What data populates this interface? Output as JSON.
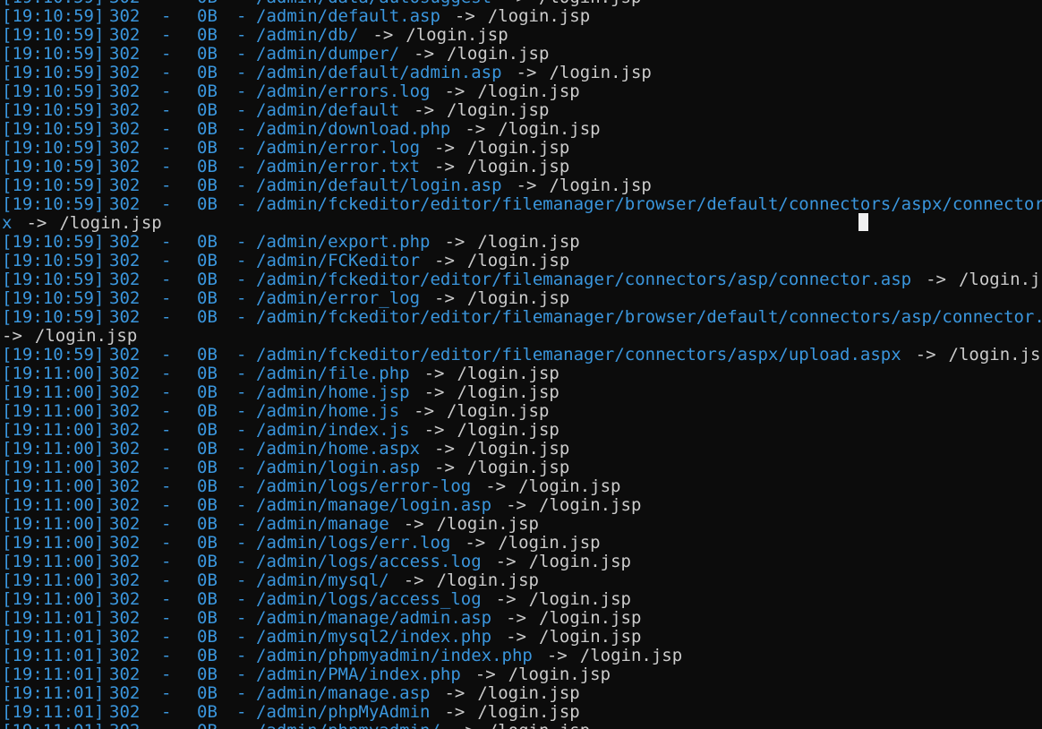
{
  "terminal": {
    "lines": [
      {
        "ts": "[19:10:59]",
        "code": "302",
        "dash": "-",
        "size": "0B",
        "sep": "-",
        "path": "/admin/data/autosuggest",
        "arrow": "->",
        "target": "/login.jsp"
      },
      {
        "ts": "[19:10:59]",
        "code": "302",
        "dash": "-",
        "size": "0B",
        "sep": "-",
        "path": "/admin/default.asp",
        "arrow": "->",
        "target": "/login.jsp"
      },
      {
        "ts": "[19:10:59]",
        "code": "302",
        "dash": "-",
        "size": "0B",
        "sep": "-",
        "path": "/admin/db/",
        "arrow": "->",
        "target": "/login.jsp"
      },
      {
        "ts": "[19:10:59]",
        "code": "302",
        "dash": "-",
        "size": "0B",
        "sep": "-",
        "path": "/admin/dumper/",
        "arrow": "->",
        "target": "/login.jsp"
      },
      {
        "ts": "[19:10:59]",
        "code": "302",
        "dash": "-",
        "size": "0B",
        "sep": "-",
        "path": "/admin/default/admin.asp",
        "arrow": "->",
        "target": "/login.jsp"
      },
      {
        "ts": "[19:10:59]",
        "code": "302",
        "dash": "-",
        "size": "0B",
        "sep": "-",
        "path": "/admin/errors.log",
        "arrow": "->",
        "target": "/login.jsp"
      },
      {
        "ts": "[19:10:59]",
        "code": "302",
        "dash": "-",
        "size": "0B",
        "sep": "-",
        "path": "/admin/default",
        "arrow": "->",
        "target": "/login.jsp"
      },
      {
        "ts": "[19:10:59]",
        "code": "302",
        "dash": "-",
        "size": "0B",
        "sep": "-",
        "path": "/admin/download.php",
        "arrow": "->",
        "target": "/login.jsp"
      },
      {
        "ts": "[19:10:59]",
        "code": "302",
        "dash": "-",
        "size": "0B",
        "sep": "-",
        "path": "/admin/error.log",
        "arrow": "->",
        "target": "/login.jsp"
      },
      {
        "ts": "[19:10:59]",
        "code": "302",
        "dash": "-",
        "size": "0B",
        "sep": "-",
        "path": "/admin/error.txt",
        "arrow": "->",
        "target": "/login.jsp"
      },
      {
        "ts": "[19:10:59]",
        "code": "302",
        "dash": "-",
        "size": "0B",
        "sep": "-",
        "path": "/admin/default/login.asp",
        "arrow": "->",
        "target": "/login.jsp"
      },
      {
        "ts": "[19:10:59]",
        "code": "302",
        "dash": "-",
        "size": "0B",
        "sep": "-",
        "path": "/admin/fckeditor/editor/filemanager/browser/default/connectors/aspx/connector.as",
        "arrow": "",
        "target": ""
      },
      {
        "wrap": true,
        "path": "x",
        "arrow": "->",
        "target": "/login.jsp"
      },
      {
        "ts": "[19:10:59]",
        "code": "302",
        "dash": "-",
        "size": "0B",
        "sep": "-",
        "path": "/admin/export.php",
        "arrow": "->",
        "target": "/login.jsp"
      },
      {
        "ts": "[19:10:59]",
        "code": "302",
        "dash": "-",
        "size": "0B",
        "sep": "-",
        "path": "/admin/FCKeditor",
        "arrow": "->",
        "target": "/login.jsp"
      },
      {
        "ts": "[19:10:59]",
        "code": "302",
        "dash": "-",
        "size": "0B",
        "sep": "-",
        "path": "/admin/fckeditor/editor/filemanager/connectors/asp/connector.asp",
        "arrow": "->",
        "target": "/login.jsp"
      },
      {
        "ts": "[19:10:59]",
        "code": "302",
        "dash": "-",
        "size": "0B",
        "sep": "-",
        "path": "/admin/error_log",
        "arrow": "->",
        "target": "/login.jsp"
      },
      {
        "ts": "[19:10:59]",
        "code": "302",
        "dash": "-",
        "size": "0B",
        "sep": "-",
        "path": "/admin/fckeditor/editor/filemanager/browser/default/connectors/asp/connector.asp",
        "arrow": "",
        "target": ""
      },
      {
        "wrap": true,
        "path": "",
        "arrow": "->",
        "target": "/login.jsp"
      },
      {
        "ts": "[19:10:59]",
        "code": "302",
        "dash": "-",
        "size": "0B",
        "sep": "-",
        "path": "/admin/fckeditor/editor/filemanager/connectors/aspx/upload.aspx",
        "arrow": "->",
        "target": "/login.jsp"
      },
      {
        "ts": "[19:11:00]",
        "code": "302",
        "dash": "-",
        "size": "0B",
        "sep": "-",
        "path": "/admin/file.php",
        "arrow": "->",
        "target": "/login.jsp"
      },
      {
        "ts": "[19:11:00]",
        "code": "302",
        "dash": "-",
        "size": "0B",
        "sep": "-",
        "path": "/admin/home.jsp",
        "arrow": "->",
        "target": "/login.jsp"
      },
      {
        "ts": "[19:11:00]",
        "code": "302",
        "dash": "-",
        "size": "0B",
        "sep": "-",
        "path": "/admin/home.js",
        "arrow": "->",
        "target": "/login.jsp"
      },
      {
        "ts": "[19:11:00]",
        "code": "302",
        "dash": "-",
        "size": "0B",
        "sep": "-",
        "path": "/admin/index.js",
        "arrow": "->",
        "target": "/login.jsp"
      },
      {
        "ts": "[19:11:00]",
        "code": "302",
        "dash": "-",
        "size": "0B",
        "sep": "-",
        "path": "/admin/home.aspx",
        "arrow": "->",
        "target": "/login.jsp"
      },
      {
        "ts": "[19:11:00]",
        "code": "302",
        "dash": "-",
        "size": "0B",
        "sep": "-",
        "path": "/admin/login.asp",
        "arrow": "->",
        "target": "/login.jsp"
      },
      {
        "ts": "[19:11:00]",
        "code": "302",
        "dash": "-",
        "size": "0B",
        "sep": "-",
        "path": "/admin/logs/error-log",
        "arrow": "->",
        "target": "/login.jsp"
      },
      {
        "ts": "[19:11:00]",
        "code": "302",
        "dash": "-",
        "size": "0B",
        "sep": "-",
        "path": "/admin/manage/login.asp",
        "arrow": "->",
        "target": "/login.jsp"
      },
      {
        "ts": "[19:11:00]",
        "code": "302",
        "dash": "-",
        "size": "0B",
        "sep": "-",
        "path": "/admin/manage",
        "arrow": "->",
        "target": "/login.jsp"
      },
      {
        "ts": "[19:11:00]",
        "code": "302",
        "dash": "-",
        "size": "0B",
        "sep": "-",
        "path": "/admin/logs/err.log",
        "arrow": "->",
        "target": "/login.jsp"
      },
      {
        "ts": "[19:11:00]",
        "code": "302",
        "dash": "-",
        "size": "0B",
        "sep": "-",
        "path": "/admin/logs/access.log",
        "arrow": "->",
        "target": "/login.jsp"
      },
      {
        "ts": "[19:11:00]",
        "code": "302",
        "dash": "-",
        "size": "0B",
        "sep": "-",
        "path": "/admin/mysql/",
        "arrow": "->",
        "target": "/login.jsp"
      },
      {
        "ts": "[19:11:00]",
        "code": "302",
        "dash": "-",
        "size": "0B",
        "sep": "-",
        "path": "/admin/logs/access_log",
        "arrow": "->",
        "target": "/login.jsp"
      },
      {
        "ts": "[19:11:01]",
        "code": "302",
        "dash": "-",
        "size": "0B",
        "sep": "-",
        "path": "/admin/manage/admin.asp",
        "arrow": "->",
        "target": "/login.jsp"
      },
      {
        "ts": "[19:11:01]",
        "code": "302",
        "dash": "-",
        "size": "0B",
        "sep": "-",
        "path": "/admin/mysql2/index.php",
        "arrow": "->",
        "target": "/login.jsp"
      },
      {
        "ts": "[19:11:01]",
        "code": "302",
        "dash": "-",
        "size": "0B",
        "sep": "-",
        "path": "/admin/phpmyadmin/index.php",
        "arrow": "->",
        "target": "/login.jsp"
      },
      {
        "ts": "[19:11:01]",
        "code": "302",
        "dash": "-",
        "size": "0B",
        "sep": "-",
        "path": "/admin/PMA/index.php",
        "arrow": "->",
        "target": "/login.jsp"
      },
      {
        "ts": "[19:11:01]",
        "code": "302",
        "dash": "-",
        "size": "0B",
        "sep": "-",
        "path": "/admin/manage.asp",
        "arrow": "->",
        "target": "/login.jsp"
      },
      {
        "ts": "[19:11:01]",
        "code": "302",
        "dash": "-",
        "size": "0B",
        "sep": "-",
        "path": "/admin/phpMyAdmin",
        "arrow": "->",
        "target": "/login.jsp"
      },
      {
        "ts": "[19:11:01]",
        "code": "302",
        "dash": "-",
        "size": "0B",
        "sep": "-",
        "path": "/admin/phpmyadmin/",
        "arrow": "->",
        "target": "/login.jsp"
      }
    ]
  },
  "colors": {
    "background": "#0c0c0c",
    "log_blue": "#3a96dd",
    "text_gray": "#cccccc",
    "cursor": "#f0f0f0"
  }
}
